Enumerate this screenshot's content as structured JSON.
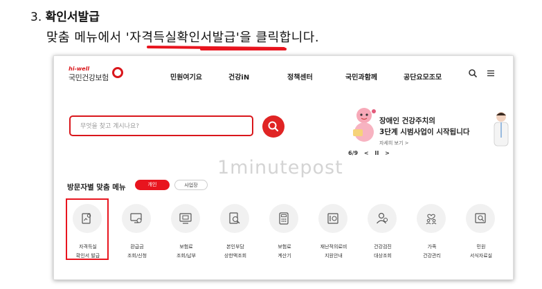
{
  "doc": {
    "step_number": "3.",
    "step_title": "확인서발급",
    "instruction_prefix": "맞춤 메뉴에서 '",
    "instruction_highlight": "자격득실확인서발급",
    "instruction_suffix": "'을 클릭합니다."
  },
  "header": {
    "brand_en": "hi-well",
    "brand_name": "국민건강보험",
    "nav": [
      "민원여기요",
      "건강iN",
      "정책센터",
      "국민과함께",
      "공단요모조모"
    ]
  },
  "search": {
    "placeholder": "무엇을 찾고 계시나요?"
  },
  "banner": {
    "line1": "장애인 건강주치의",
    "line2": "3단계 시범사업이 시작됩니다",
    "more": "자세히 보기 >",
    "page": "6/9",
    "prev": "<",
    "pause": "II",
    "next": ">"
  },
  "watermark": "1minutepost",
  "menu": {
    "title": "방문자별 맞춤 메뉴",
    "tab_active": "개인",
    "tab_inactive": "사업장",
    "items": [
      {
        "l1": "자격득실",
        "l2": "확인서 발급",
        "icon": "certificate-icon"
      },
      {
        "l1": "환급금",
        "l2": "조회/신청",
        "icon": "refund-monitor-icon"
      },
      {
        "l1": "보험료",
        "l2": "조회/납부",
        "icon": "premium-payment-icon"
      },
      {
        "l1": "본인부담",
        "l2": "상한액조회",
        "icon": "copay-search-icon"
      },
      {
        "l1": "보험료",
        "l2": "계산기",
        "icon": "calculator-icon"
      },
      {
        "l1": "재난적의료비",
        "l2": "지원안내",
        "icon": "medical-support-icon"
      },
      {
        "l1": "건강검진",
        "l2": "대상조회",
        "icon": "checkup-person-icon"
      },
      {
        "l1": "가족",
        "l2": "건강관리",
        "icon": "family-care-icon"
      },
      {
        "l1": "민원",
        "l2": "서식자료실",
        "icon": "forms-archive-icon"
      }
    ]
  },
  "colors": {
    "accent": "#e8141e"
  }
}
